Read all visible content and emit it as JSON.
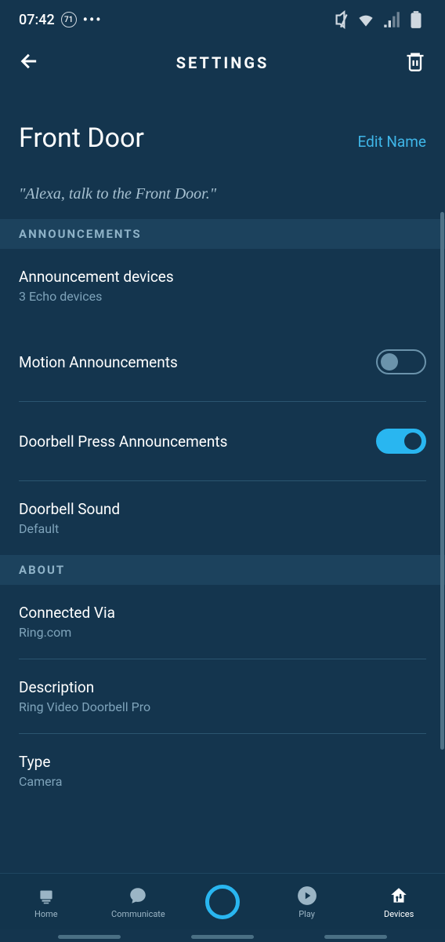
{
  "status": {
    "time": "07:42",
    "battery_pct": "71"
  },
  "header": {
    "title": "SETTINGS"
  },
  "device": {
    "title": "Front Door",
    "edit_label": "Edit Name",
    "instruction": "\"Alexa, talk to the Front Door.\""
  },
  "sections": {
    "announcements": {
      "header": "ANNOUNCEMENTS",
      "items": {
        "devices": {
          "label": "Announcement devices",
          "sub": "3 Echo devices"
        },
        "motion": {
          "label": "Motion Announcements"
        },
        "press": {
          "label": "Doorbell Press Announcements"
        },
        "sound": {
          "label": "Doorbell Sound",
          "sub": "Default"
        }
      }
    },
    "about": {
      "header": "ABOUT",
      "items": {
        "connected": {
          "label": "Connected Via",
          "sub": "Ring.com"
        },
        "description": {
          "label": "Description",
          "sub": "Ring Video Doorbell Pro"
        },
        "type": {
          "label": "Type",
          "sub": "Camera"
        }
      }
    }
  },
  "nav": {
    "home": "Home",
    "communicate": "Communicate",
    "play": "Play",
    "devices": "Devices"
  }
}
